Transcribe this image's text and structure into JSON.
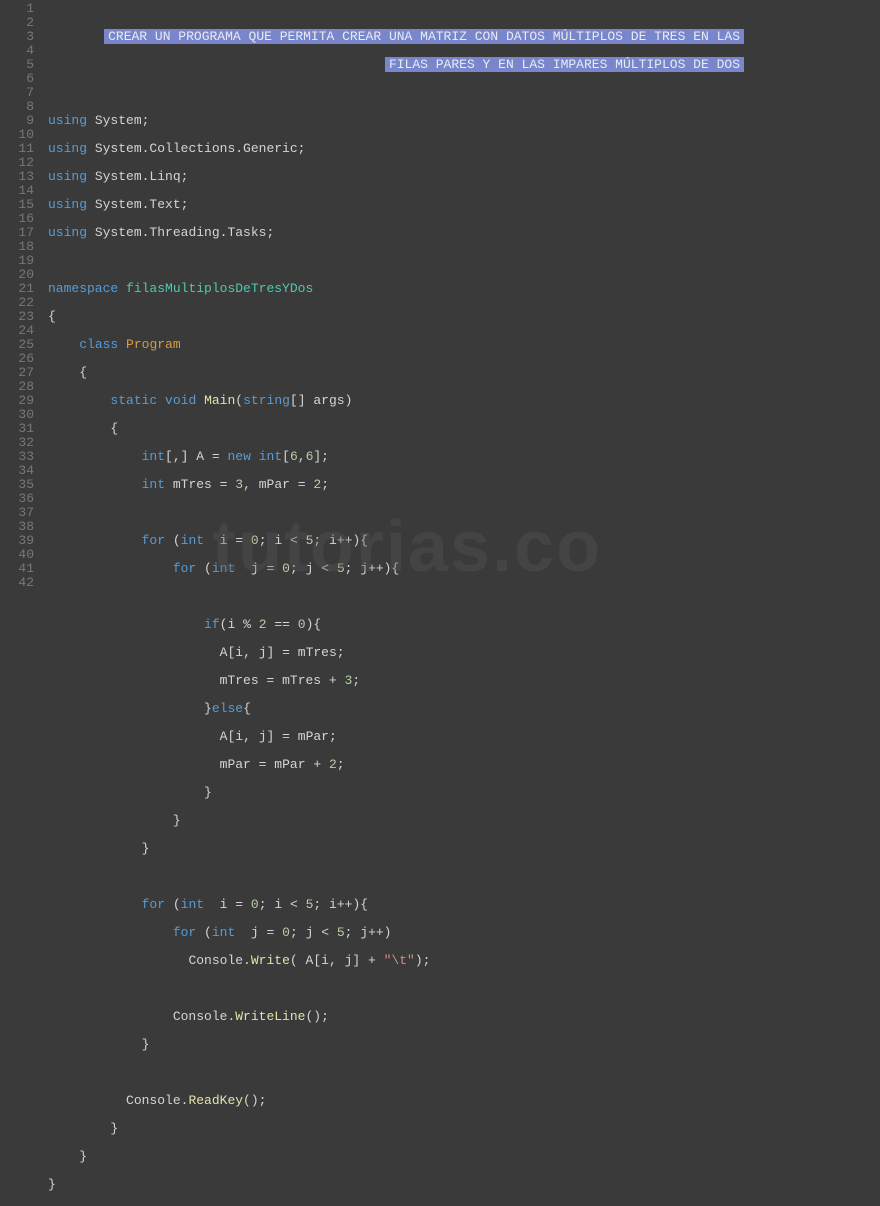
{
  "watermark": "tutorias.co",
  "gutter": {
    "start": 1,
    "end": 42
  },
  "comment": {
    "line1": "CREAR UN PROGRAMA QUE PERMITA CREAR UNA MATRIZ CON DATOS MÚLTIPLOS DE TRES EN LAS",
    "line2": "FILAS PARES Y EN LAS IMPARES MÚLTIPLOS DE DOS"
  },
  "code": {
    "using1": {
      "kw": "using",
      "ns": "System"
    },
    "using2": {
      "kw": "using",
      "ns": "System.Collections.Generic"
    },
    "using3": {
      "kw": "using",
      "ns": "System.Linq"
    },
    "using4": {
      "kw": "using",
      "ns": "System.Text"
    },
    "using5": {
      "kw": "using",
      "ns": "System.Threading.Tasks"
    },
    "ns_kw": "namespace",
    "ns_name": "filasMultiplosDeTresYDos",
    "class_kw": "class",
    "class_name": "Program",
    "static_kw": "static",
    "void_kw": "void",
    "main_name": "Main",
    "string_kw": "string",
    "args": "args",
    "int_kw": "int",
    "new_kw": "new",
    "for_kw": "for",
    "if_kw": "if",
    "else_kw": "else",
    "varA": "A",
    "dim1": "6",
    "dim2": "6",
    "mTres": "mTres",
    "mTres_init": "3",
    "mPar": "mPar",
    "mPar_init": "2",
    "i": "i",
    "j": "j",
    "zero": "0",
    "five": "5",
    "two": "2",
    "three": "3",
    "console": "Console",
    "write": "Write",
    "writeline": "WriteLine",
    "readkey": "ReadKey",
    "tab_literal": "\"\\t\""
  }
}
